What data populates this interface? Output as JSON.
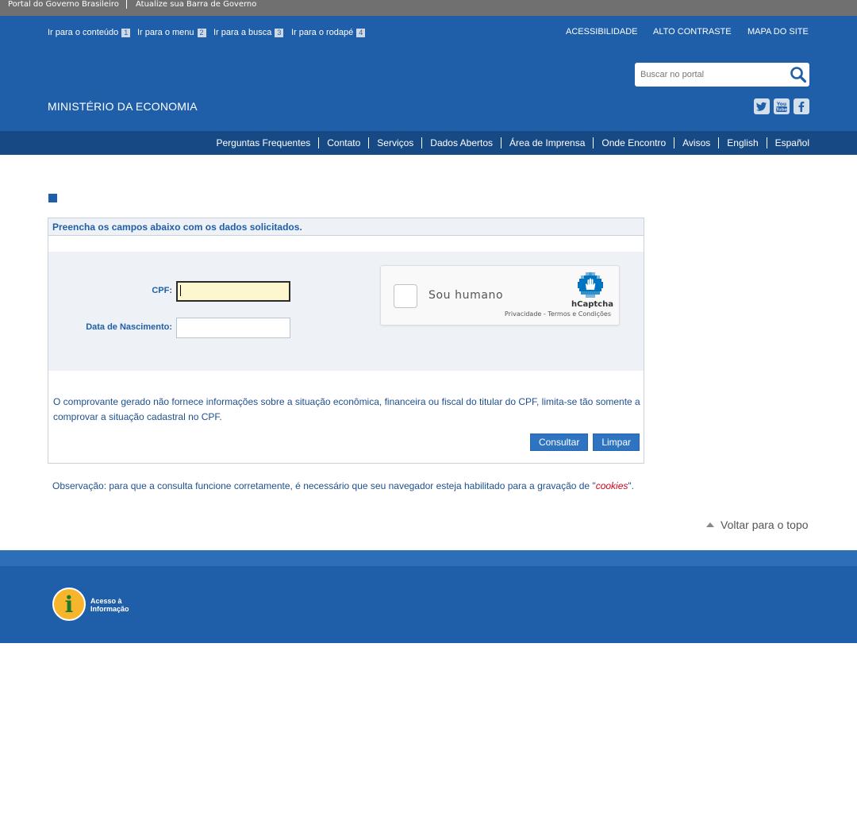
{
  "govbar": {
    "portal": "Portal do Governo Brasileiro",
    "update": "Atualize sua Barra de Governo"
  },
  "skip_links": [
    {
      "label": "Ir para o conteúdo",
      "num": "1"
    },
    {
      "label": "Ir para o menu",
      "num": "2"
    },
    {
      "label": "Ir para a busca",
      "num": "3"
    },
    {
      "label": "Ir para o rodapé",
      "num": "4"
    }
  ],
  "top_links": {
    "accessibility": "ACESSIBILIDADE",
    "contrast": "ALTO CONTRASTE",
    "sitemap": "MAPA DO SITE"
  },
  "search": {
    "placeholder": "Buscar no portal"
  },
  "ministry": "MINISTÉRIO DA ECONOMIA",
  "nav": [
    "Perguntas Frequentes",
    "Contato",
    "Serviços",
    "Dados Abertos",
    "Área de Imprensa",
    "Onde Encontro",
    "Avisos",
    "English",
    "Español"
  ],
  "form": {
    "header": "Preencha os campos abaixo com os dados solicitados.",
    "cpf_label": "CPF:",
    "cpf_value": "",
    "birth_label": "Data de Nascimento:",
    "birth_value": ""
  },
  "captcha": {
    "label": "Sou humano",
    "brand": "hCaptcha",
    "legal": "Privacidade - Termos e Condições"
  },
  "notice": "O comprovante gerado não fornece informações sobre a situação econômica, financeira ou fiscal do titular do CPF, limita-se tão somente a comprovar a situação cadastral no CPF.",
  "buttons": {
    "submit": "Consultar",
    "clear": "Limpar"
  },
  "observation": {
    "before": "Observação: para que a consulta funcione corretamente, é necessário que seu navegador esteja habilitado para a gravação de \"",
    "cookies": "cookies",
    "after": "\"."
  },
  "back_to_top": "Voltar para o topo",
  "footer": {
    "lai_line1": "Acesso à",
    "lai_line2": "Informação"
  },
  "colors": {
    "primary": "#1f5ea8",
    "nav": "#174a85",
    "govbar": "#707070",
    "button": "#2f74c0"
  }
}
